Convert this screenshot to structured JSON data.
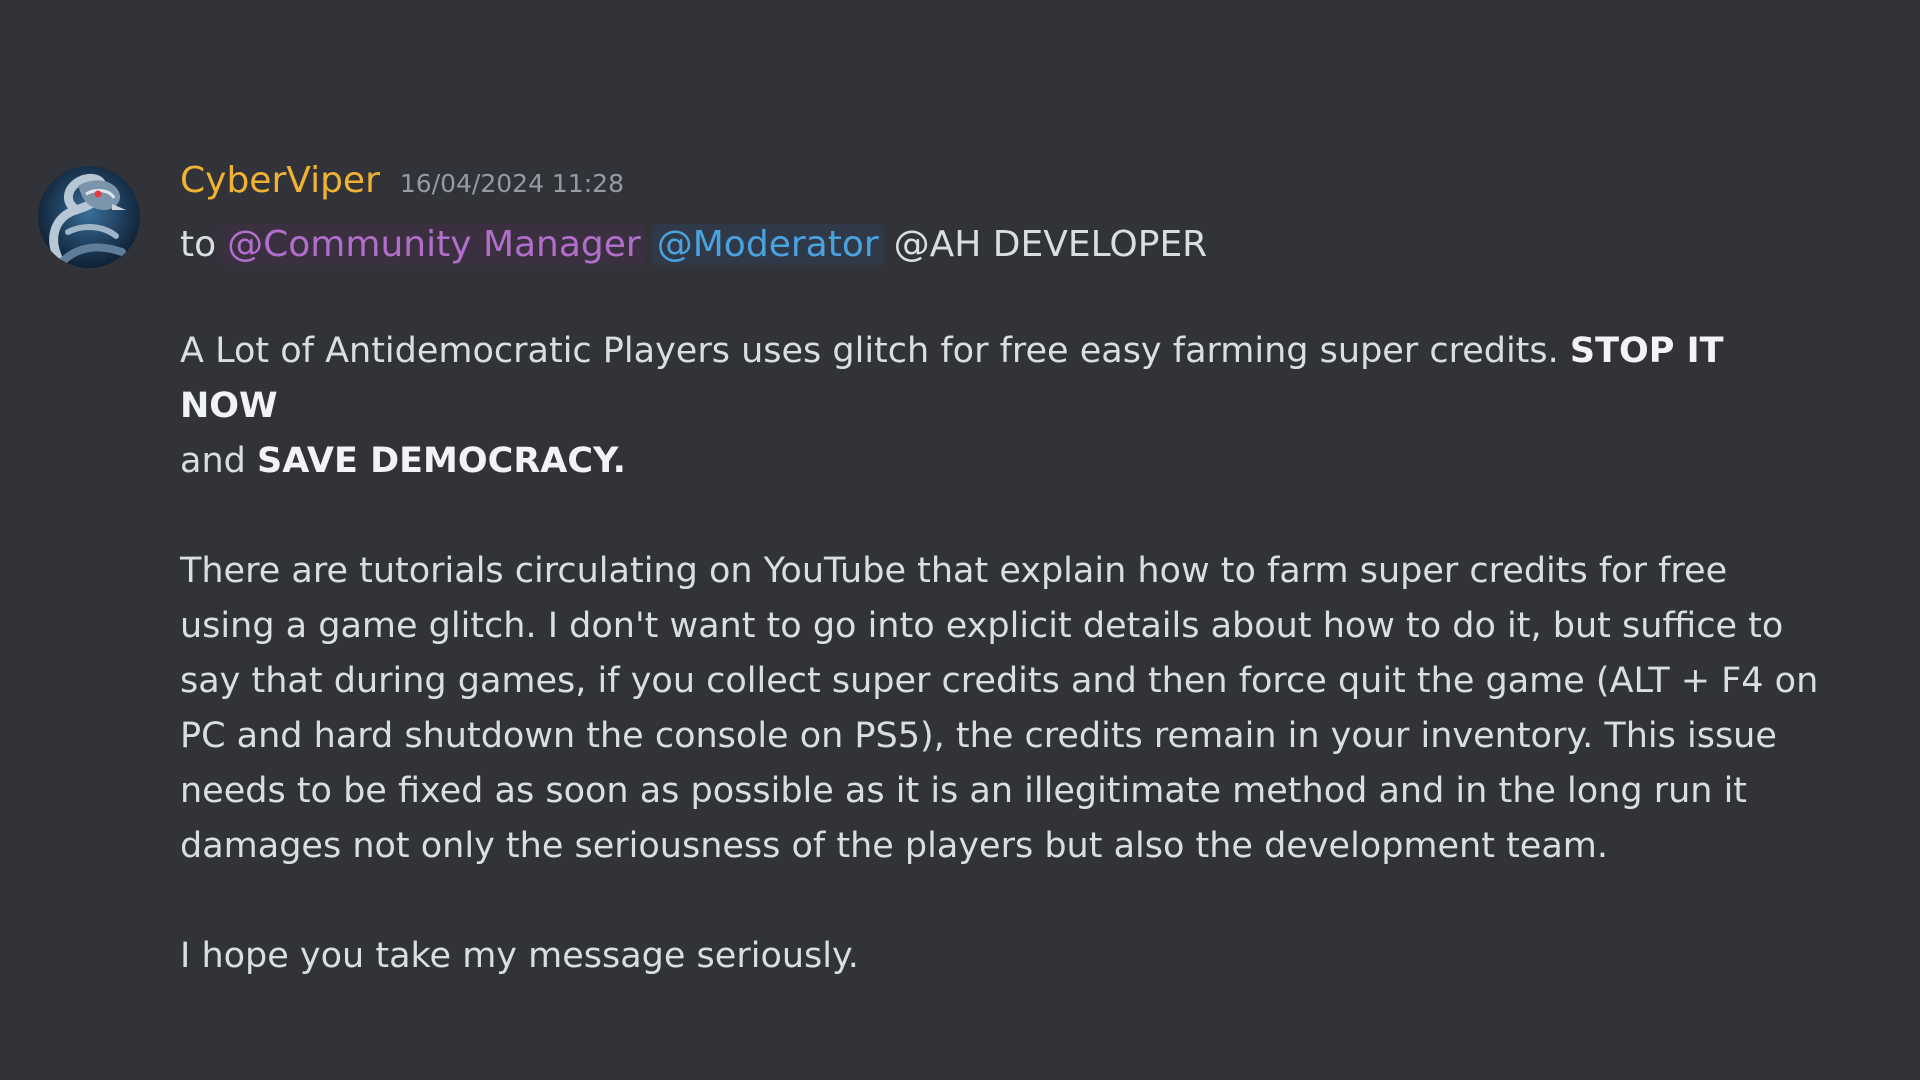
{
  "message": {
    "username": "CyberViper",
    "timestamp": "16/04/2024 11:28",
    "avatar_icon": "cobra-avatar-icon",
    "to_label": "to",
    "mentions": [
      {
        "label": "@Community Manager",
        "color": "#b26ecb"
      },
      {
        "label": "@Moderator",
        "color": "#4aa3df"
      },
      {
        "label": "@AH DEVELOPER",
        "color": "#dbdee1"
      }
    ],
    "paragraph1": {
      "text_a": "A Lot of Antidemocratic Players uses glitch for free easy farming super credits.",
      "bold_a": "STOP IT NOW",
      "text_b": "and",
      "bold_b": "SAVE DEMOCRACY."
    },
    "paragraph2": "There are tutorials circulating on YouTube that explain how to farm super credits for free using a game glitch. I don't want to go into explicit details about how to do it, but suffice to say that during games, if you collect super credits and then force quit the game (ALT + F4 on PC and hard shutdown the console on PS5), the credits remain in your inventory. This issue needs to be fixed as soon as possible as it is an illegitimate method and in the long run it damages not only the seriousness of the players but also the development team.",
    "paragraph3": "I hope you take my message seriously."
  },
  "colors": {
    "background": "#313338",
    "username": "#f0b232",
    "text": "#dbdee1",
    "timestamp": "#949ba4"
  }
}
